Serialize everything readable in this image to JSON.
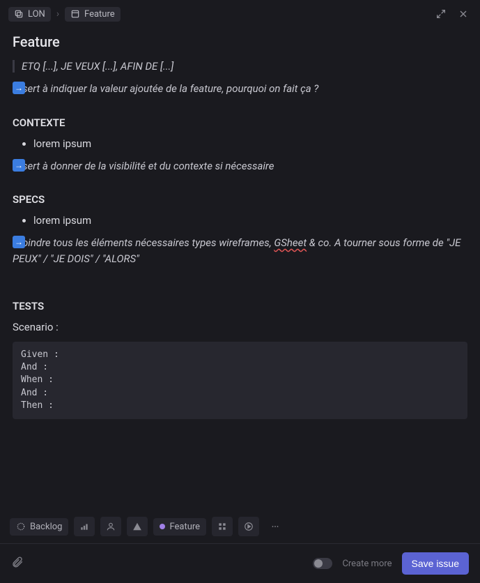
{
  "breadcrumb": {
    "workspace": "LON",
    "separator": "›",
    "template": "Feature"
  },
  "title": "Feature",
  "quote": "ETQ [...], JE VEUX [...], AFIN DE [...]",
  "intro_note": "sert à indiquer la valeur ajoutée de la feature, pourquoi on fait ça ?",
  "sections": {
    "contexte": {
      "heading": "CONTEXTE",
      "items": [
        "lorem ipsum"
      ],
      "note": "sert à donner de la visibilité et du contexte si nécessaire"
    },
    "specs": {
      "heading": "SPECS",
      "items": [
        "lorem ipsum"
      ],
      "note_pre": "oindre tous les éléments nécessaires types wireframes, ",
      "note_link": "GSheet",
      "note_post": " & co. A tourner sous forme de \"JE PEUX\" / \"JE DOIS\"  / \"ALORS\""
    },
    "tests": {
      "heading": "TESTS",
      "scenario_label": "Scenario :",
      "code": "Given :\nAnd :\nWhen :\nAnd :\nThen :"
    }
  },
  "properties": {
    "status": "Backlog",
    "label": "Feature",
    "label_color": "#a080e8"
  },
  "footer": {
    "create_more": "Create more",
    "save": "Save issue"
  }
}
